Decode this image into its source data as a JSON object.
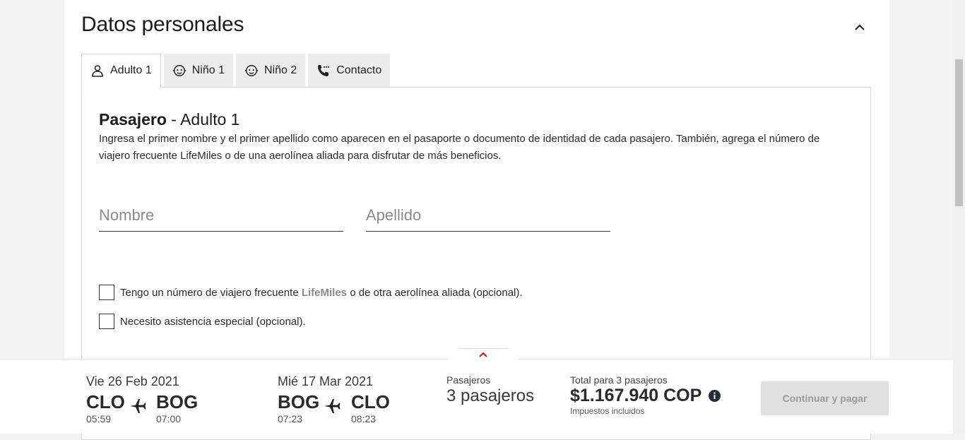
{
  "section": {
    "title": "Datos personales"
  },
  "tabs": [
    {
      "label": "Adulto 1",
      "icon": "user-icon",
      "active": true
    },
    {
      "label": "Niño 1",
      "icon": "child-face-icon",
      "active": false
    },
    {
      "label": "Niño 2",
      "icon": "child-face-icon",
      "active": false
    },
    {
      "label": "Contacto",
      "icon": "phone-icon",
      "active": false
    }
  ],
  "passenger": {
    "title_bold": "Pasajero",
    "title_rest": " - Adulto 1",
    "description": "Ingresa el primer nombre y el primer apellido como aparecen en el pasaporte o documento de identidad de cada pasajero. También, agrega el número de viajero frecuente LifeMiles o de una aerolínea aliada para disfrutar de más beneficios.",
    "first_name_placeholder": "Nombre",
    "last_name_placeholder": "Apellido",
    "ff_before": "Tengo un número de viajero frecuente ",
    "ff_brand": "LifeMiles",
    "ff_after": " o de otra aerolínea aliada (opcional).",
    "assist_label": "Necesito asistencia especial (opcional)."
  },
  "summary": {
    "outbound": {
      "date": "Vie 26 Feb 2021",
      "from": "CLO",
      "from_time": "05:59",
      "to": "BOG",
      "to_time": "07:00"
    },
    "return": {
      "date": "Mié 17 Mar 2021",
      "from": "BOG",
      "from_time": "07:23",
      "to": "CLO",
      "to_time": "08:23"
    },
    "passengers_label": "Pasajeros",
    "passengers_value": "3 pasajeros",
    "total_label": "Total para 3 pasajeros",
    "total_value": "$1.167.940 COP",
    "taxes_note": "Impuestos incluidos",
    "pay_button": "Continuar y pagar"
  },
  "colors": {
    "accent_red": "#d2131d",
    "disabled_button_bg": "#e0e0e0",
    "info_icon": "#1f2d3d"
  }
}
